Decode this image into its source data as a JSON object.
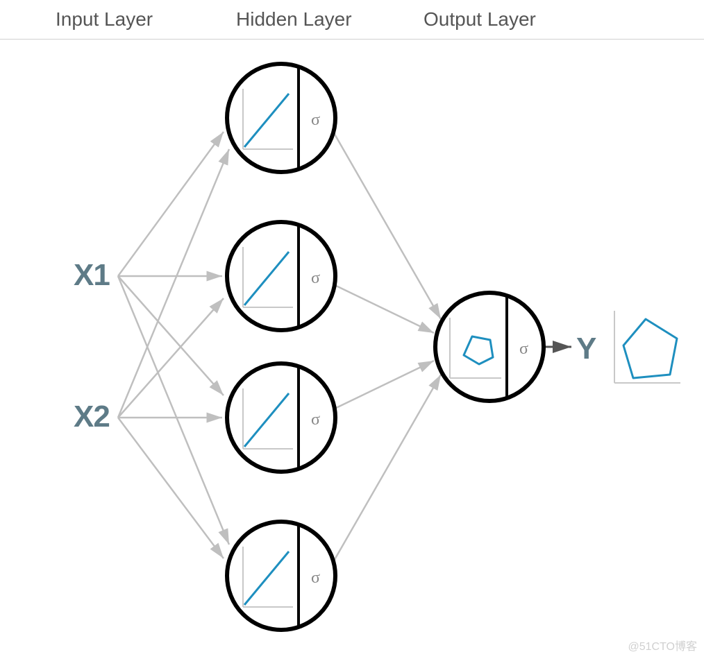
{
  "diagram": {
    "layers": {
      "input": {
        "title": "Input Layer",
        "nodes": [
          "X1",
          "X2"
        ]
      },
      "hidden": {
        "title": "Hidden Layer",
        "count": 4,
        "activation": "σ",
        "function_shape": "linear"
      },
      "output": {
        "title": "Output Layer",
        "count": 1,
        "activation": "σ",
        "function_shape": "pentagon",
        "label": "Y"
      }
    },
    "output_result_shape": "pentagon",
    "connections": "fully_connected"
  },
  "colors": {
    "node_stroke": "#000000",
    "axis": "#c0c0c0",
    "plot_line": "#1e8fbf",
    "arrow": "#bfbfbf",
    "text_header": "#555555",
    "text_io": "#5e7b87"
  },
  "watermark": "@51CTO博客"
}
